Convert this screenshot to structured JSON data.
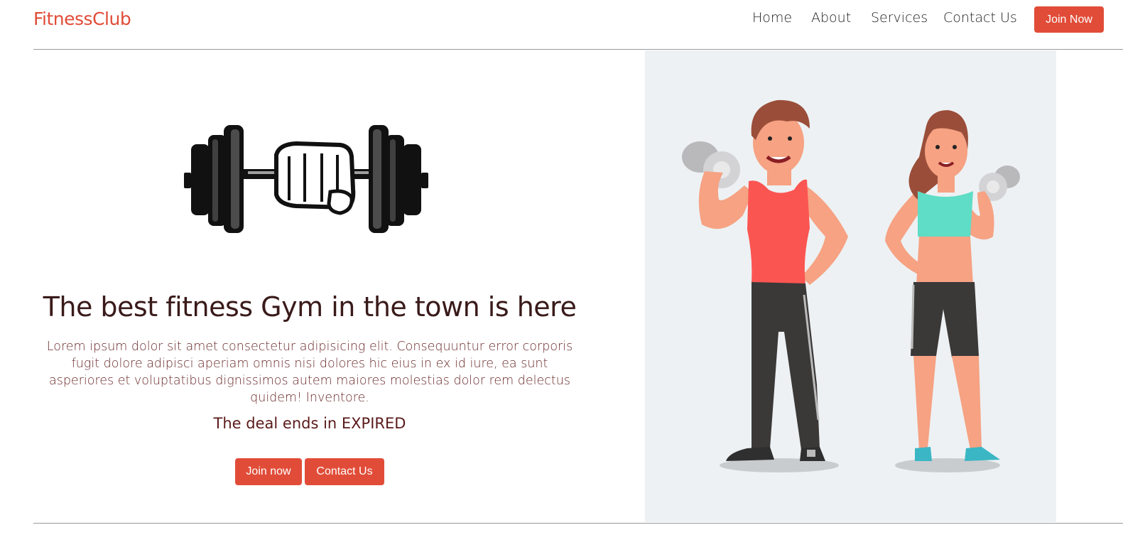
{
  "nav": {
    "brand": "FitnessClub",
    "links": [
      "Home",
      "About",
      "Services",
      "Contact Us"
    ],
    "join_button": "Join Now"
  },
  "hero": {
    "title": "The best fitness Gym in the town is here",
    "text": "Lorem ipsum dolor sit amet consectetur adipisicing elit. Consequuntur error corporis fugit dolore adipisci aperiam omnis nisi dolores hic eius in ex id iure, ea sunt asperiores et voluptatibus dignissimos autem maiores molestias dolor rem delectus quidem! Inventore.",
    "deal": "The deal ends in EXPIRED",
    "join_button": "Join now",
    "contact_button": "Contact Us"
  },
  "colors": {
    "accent": "#e14c38",
    "illustration_bg": "#edf1f3"
  },
  "icons": {
    "logo": "dumbbell-fist-icon",
    "illustration": "fitness-couple-illustration"
  }
}
